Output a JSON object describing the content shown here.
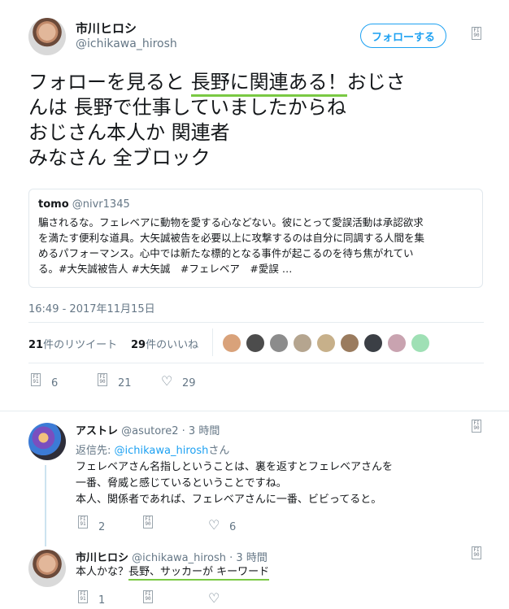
{
  "main_tweet": {
    "author_name": "市川ヒロシ",
    "author_handle": "@ichikawa_hirosh",
    "follow_label": "フォローする",
    "text_line1_before": "フォローを見ると ",
    "text_line1_highlight": "長野に関連ある！",
    "text_line1_after": "おじさ",
    "text_line2": "んは 長野で仕事していましたからね",
    "text_line3": "おじさん本人か 関連者",
    "text_line4": "みなさん 全ブロック",
    "timestamp": "16:49 - 2017年11月15日",
    "retweet_count": "21",
    "retweet_label": "件のリツイート",
    "like_count": "29",
    "like_label": "件のいいね",
    "action_reply": "6",
    "action_retweet": "21",
    "action_like": "29"
  },
  "quoted_tweet": {
    "author_name": "tomo",
    "author_handle": "@nivr1345",
    "line1": "騙されるな。フェレベアに動物を愛する心などない。彼にとって愛誤活動は承認欲求",
    "line2": "を満たす便利な道具。大矢誠被告を必要以上に攻撃するのは自分に同調する人間を集",
    "line3": "めるパフォーマンス。心中では新たな標的となる事件が起こるのを待ち焦がれてい",
    "line4": "る。#大矢誠被告人 #大矢誠　#フェレベア　#愛誤 …"
  },
  "reply1": {
    "author_name": "アストレ",
    "author_handle": "@asutore2",
    "time": "· 3 時間",
    "reply_to_prefix": "返信先: ",
    "reply_to_handle": "@ichikawa_hirosh",
    "reply_to_suffix": "さん",
    "line1": "フェレベアさん名指しということは、裏を返すとフェレベアさんを",
    "line2": "一番、脅威と感じているということですね。",
    "line3": "本人、関係者であれば、フェレベアさんに一番、ビビってると。",
    "action_reply": "2",
    "action_retweet": "",
    "action_like": "6"
  },
  "reply2": {
    "author_name": "市川ヒロシ",
    "author_handle": "@ichikawa_hirosh",
    "time": "· 3 時間",
    "text_before": "本人かな？",
    "text_highlight": "長野、サッカーが キーワード",
    "action_reply": "1"
  },
  "icons": {
    "reply": "reply-icon",
    "retweet": "retweet-icon",
    "like": "heart-icon",
    "more": "more-icon"
  },
  "colors": {
    "accent": "#1da1f2",
    "highlight": "#7ac943",
    "muted": "#657786"
  }
}
